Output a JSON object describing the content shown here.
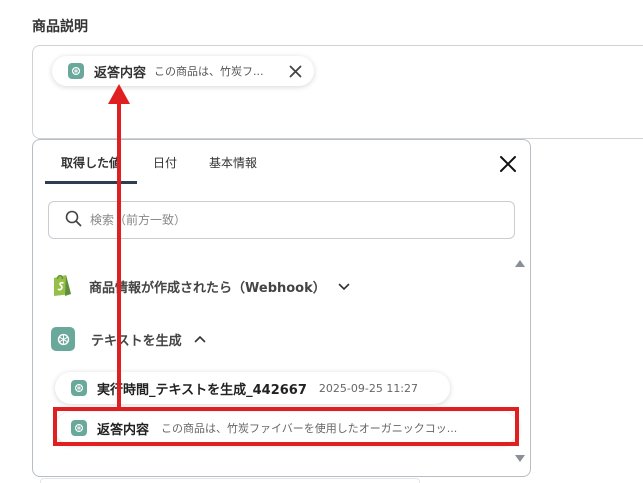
{
  "field": {
    "label": "商品説明",
    "chip": {
      "title": "返答内容",
      "value": "この商品は、竹炭フ..."
    }
  },
  "panel": {
    "tabs": [
      {
        "label": "取得した値"
      },
      {
        "label": "日付"
      },
      {
        "label": "基本情報"
      }
    ],
    "search": {
      "placeholder": "検索（前方一致）"
    },
    "groups": [
      {
        "label": "商品情報が作成されたら（Webhook）",
        "icon": "shopify-icon",
        "expanded": false
      },
      {
        "label": "テキストを生成",
        "icon": "chatgpt-icon",
        "expanded": true
      }
    ],
    "items": [
      {
        "title": "実行時間_テキストを生成_442667",
        "meta": "2025-09-25 11:27"
      },
      {
        "title": "返答内容",
        "meta": "この商品は、竹炭ファイバーを使用したオーガニックコッ..."
      }
    ]
  },
  "annotation": {
    "color": "#e02020"
  },
  "colors": {
    "accent": "#2c3e50",
    "gpt": "#6aa89b",
    "shopify": "#95bf47"
  }
}
